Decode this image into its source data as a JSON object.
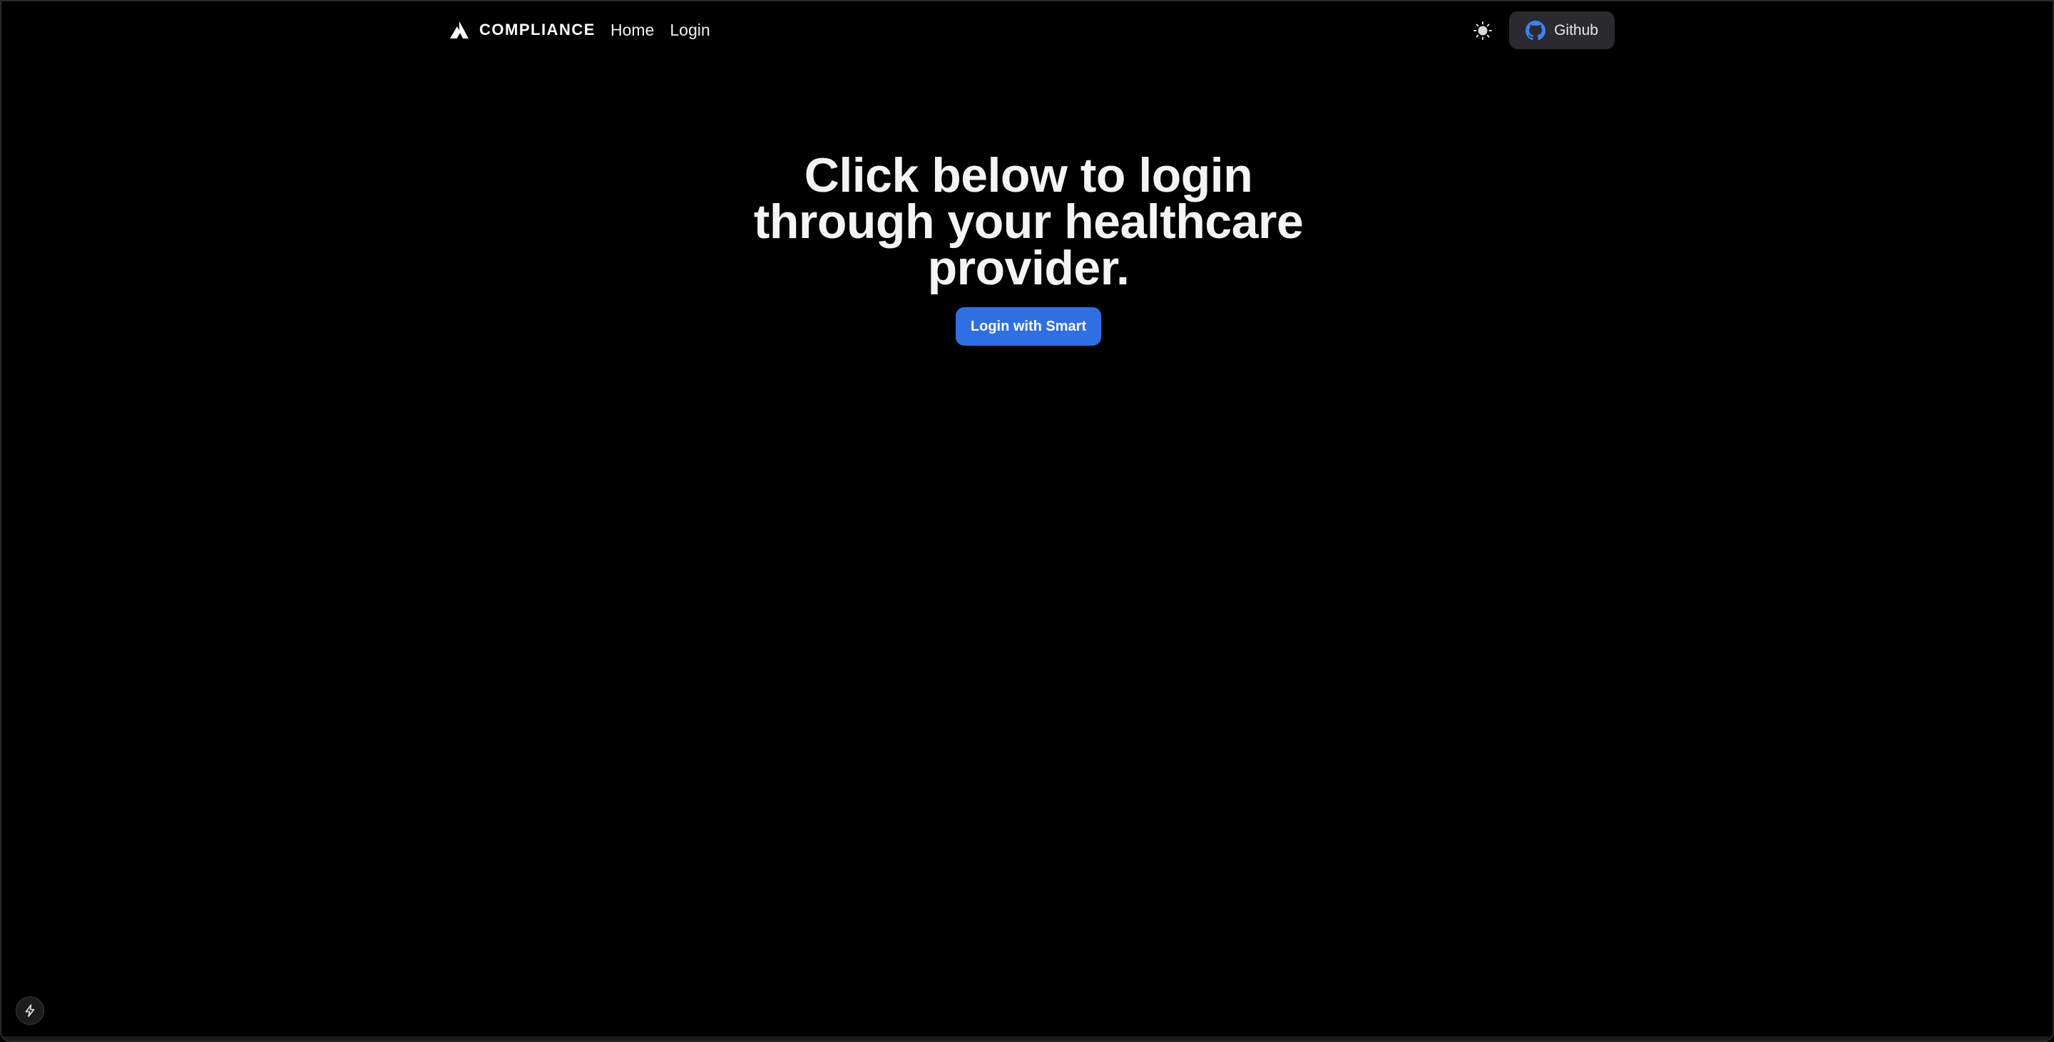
{
  "navbar": {
    "brand_name": "COMPLIANCE",
    "links": [
      {
        "label": "Home"
      },
      {
        "label": "Login"
      }
    ],
    "theme_toggle_icon": "sun-icon",
    "github": {
      "label": "Github",
      "icon": "github-icon",
      "icon_color": "#3b82f6"
    }
  },
  "hero": {
    "title": "Click below to login through your healthcare provider.",
    "button_label": "Login with Smart",
    "button_color": "#2f6fe4"
  },
  "dev_indicator": {
    "icon": "lightning-icon"
  },
  "colors": {
    "background": "#000000",
    "text": "#ffffff",
    "accent": "#2f6fe4"
  }
}
